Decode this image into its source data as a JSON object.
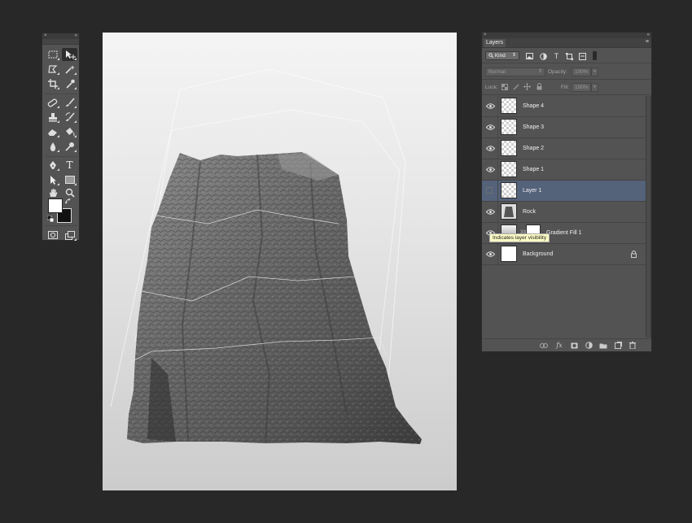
{
  "tools_panel": {
    "close_glyph": "×",
    "collapse_glyph": "«",
    "tools": [
      {
        "name": "rect-marquee-icon",
        "active": false
      },
      {
        "name": "move-tool-icon",
        "active": true
      },
      {
        "name": "lasso-icon",
        "active": false
      },
      {
        "name": "magic-wand-icon",
        "active": false
      },
      {
        "name": "crop-icon",
        "active": false
      },
      {
        "name": "eyedropper-icon",
        "active": false
      },
      {
        "name": "healing-brush-icon",
        "active": false
      },
      {
        "name": "brush-icon",
        "active": false
      },
      {
        "name": "clone-stamp-icon",
        "active": false
      },
      {
        "name": "history-brush-icon",
        "active": false
      },
      {
        "name": "eraser-icon",
        "active": false
      },
      {
        "name": "paint-bucket-icon",
        "active": false
      },
      {
        "name": "blur-icon",
        "active": false
      },
      {
        "name": "dodge-icon",
        "active": false
      },
      {
        "name": "pen-icon",
        "active": false
      },
      {
        "name": "type-tool-icon",
        "active": false
      },
      {
        "name": "path-selection-icon",
        "active": false
      },
      {
        "name": "rectangle-shape-icon",
        "active": false
      },
      {
        "name": "hand-icon",
        "active": false
      },
      {
        "name": "zoom-icon",
        "active": false
      }
    ],
    "type_glyph": "T",
    "foreground_color": "#ffffff",
    "background_color": "#111111"
  },
  "layers_panel": {
    "close_glyph": "×",
    "collapse_glyph": "«",
    "tab_label": "Layers",
    "menu_glyph": "≡",
    "filter_kind_label": "Kind",
    "filter_kind_arrows": "⇕",
    "type_filter_glyph": "T",
    "blend_mode": "Normal",
    "blend_arrows": "⇕",
    "opacity_label": "Opacity:",
    "opacity_value": "100%",
    "spin_glyph": "▾",
    "lock_label": "Lock:",
    "fill_label": "Fill:",
    "fill_value": "100%",
    "tooltip": "Indicates layer visibility",
    "chain_glyph": "⛓",
    "fx_label": "fx",
    "layers": [
      {
        "name": "Shape 4",
        "visible": true,
        "selected": false
      },
      {
        "name": "Shape 3",
        "visible": true,
        "selected": false
      },
      {
        "name": "Shape 2",
        "visible": true,
        "selected": false
      },
      {
        "name": "Shape 1",
        "visible": true,
        "selected": false
      },
      {
        "name": "Layer 1",
        "visible": false,
        "selected": true
      },
      {
        "name": "Rock",
        "visible": true,
        "selected": false
      },
      {
        "name": "Gradient Fill 1",
        "visible": true,
        "selected": false
      },
      {
        "name": "Background",
        "visible": true,
        "selected": false,
        "locked": true
      }
    ]
  },
  "colors": {
    "app_background": "#282828",
    "panel": "#535353",
    "selected_layer": "#54627a",
    "tooltip_bg": "#fbfbc4"
  }
}
